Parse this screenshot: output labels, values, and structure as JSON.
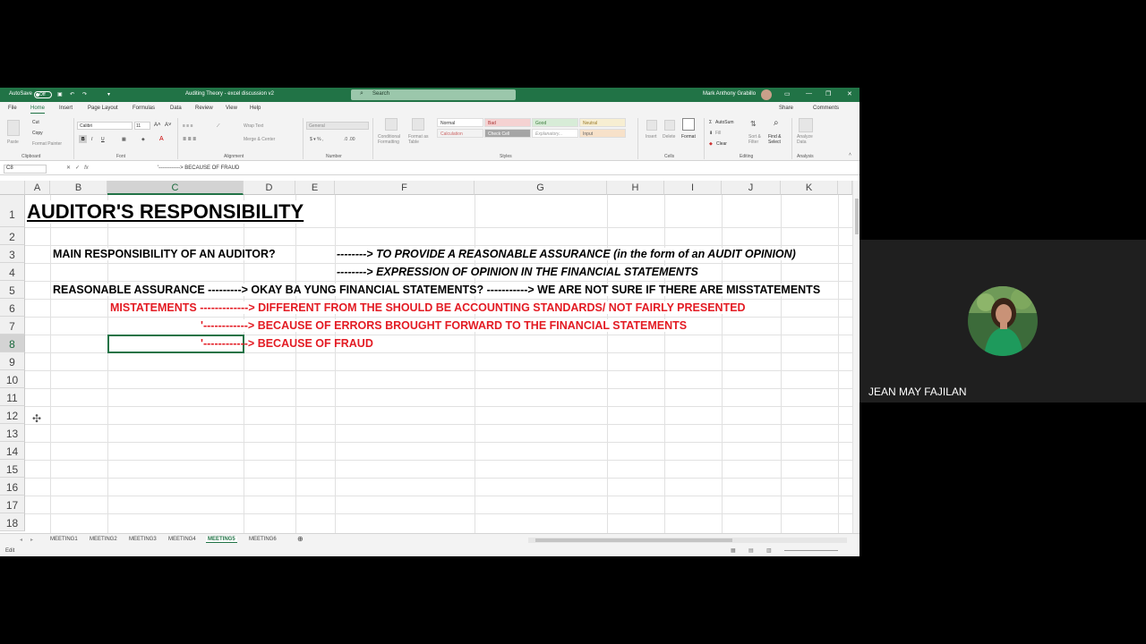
{
  "window": {
    "autosave_label": "AutoSave",
    "autosave_state": "Off",
    "doc_title": "Auditing Theory - excel discussion v2",
    "search_placeholder": "Search",
    "user_name": "Mark Anthony Grabillo"
  },
  "menu": [
    "File",
    "Home",
    "Insert",
    "Page Layout",
    "Formulas",
    "Data",
    "Review",
    "View",
    "Help"
  ],
  "menu_right": {
    "share": "Share",
    "comments": "Comments"
  },
  "ribbon": {
    "groups": [
      "Clipboard",
      "Font",
      "Alignment",
      "Number",
      "Styles",
      "Cells",
      "Editing",
      "Analysis"
    ],
    "clipboard": {
      "paste": "Paste",
      "cut": "Cut",
      "copy": "Copy",
      "format_painter": "Format Painter"
    },
    "font_name": "Calibri",
    "font_size": "11",
    "wrap_text": "Wrap Text",
    "merge_center": "Merge & Center",
    "number_format": "General",
    "styles": [
      "Normal",
      "Bad",
      "Good",
      "Neutral",
      "Calculation",
      "Check Cell",
      "Explanatory...",
      "Input"
    ],
    "conditional": "Conditional Formatting",
    "format_table": "Format as Table",
    "cells": [
      "Insert",
      "Delete",
      "Format"
    ],
    "editing": {
      "autosum": "AutoSum",
      "fill": "Fill",
      "clear": "Clear",
      "sort": "Sort & Filter",
      "find": "Find & Select"
    },
    "analyze": "Analyze Data"
  },
  "formula": {
    "name_box": "C8",
    "value": "'------------> BECAUSE OF FRAUD"
  },
  "columns": [
    "A",
    "B",
    "C",
    "D",
    "E",
    "F",
    "G",
    "H",
    "I",
    "J",
    "K"
  ],
  "rows": [
    "1",
    "2",
    "3",
    "4",
    "5",
    "6",
    "7",
    "8",
    "9",
    "10",
    "11",
    "12",
    "13",
    "14",
    "15",
    "16",
    "17",
    "18"
  ],
  "cells": {
    "a1": "AUDITOR'S RESPONSIBILITY",
    "b3": "MAIN RESPONSIBILITY OF AN AUDITOR?",
    "e3": "--------> TO PROVIDE A REASONABLE ASSURANCE (in the form of an AUDIT OPINION)",
    "e4": "--------> EXPRESSION OF OPINION IN THE FINANCIAL STATEMENTS",
    "b5": "REASONABLE ASSURANCE ---------> OKAY BA YUNG FINANCIAL STATEMENTS? -----------> WE ARE NOT SURE IF THERE ARE MISSTATEMENTS",
    "c6": "MISTATEMENTS -------------> DIFFERENT FROM THE SHOULD BE ACCOUNTING STANDARDS/ NOT FAIRLY PRESENTED",
    "c7": "'------------> BECAUSE OF ERRORS BROUGHT FORWARD TO THE FINANCIAL STATEMENTS",
    "c8": "'------------> BECAUSE OF FRAUD"
  },
  "sheets": [
    "MEETING1",
    "MEETING2",
    "MEETING3",
    "MEETING4",
    "MEETING5",
    "MEETING6"
  ],
  "active_sheet_index": 4,
  "status": {
    "mode": "Edit"
  },
  "participant": {
    "name": "JEAN MAY FAJILAN"
  },
  "colors": {
    "excel_green": "#217346",
    "red_text": "#e31b23"
  }
}
